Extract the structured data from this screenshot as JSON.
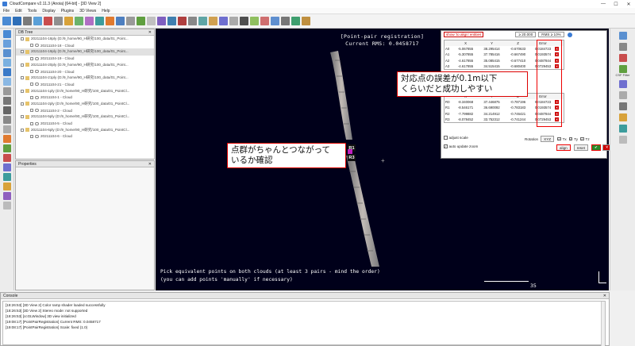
{
  "window": {
    "title": "CloudCompare v2.11.3 (Anoia) [64-bit] - [3D View 2]",
    "controls": [
      "—",
      "☐",
      "✕"
    ]
  },
  "menu": [
    "File",
    "Edit",
    "Tools",
    "Display",
    "Plugins",
    "3D Views",
    "Help"
  ],
  "db_tree": {
    "title": "DB Tree",
    "items": [
      {
        "kind": "parent",
        "label": "20211104-18ply (D:/9_home/90_H研究/100_data/01_Point...",
        "selected": false
      },
      {
        "kind": "child",
        "label": "20211104-18 - Cloud"
      },
      {
        "kind": "parent",
        "label": "20211104-19ply (D:/9_home/90_H研究/100_data/01_Point...",
        "selected": true
      },
      {
        "kind": "child",
        "label": "20211104-19 - Cloud"
      },
      {
        "kind": "parent",
        "label": "20211104-20ply (D:/9_home/90_H研究/100_data/01_Point...",
        "selected": false
      },
      {
        "kind": "child",
        "label": "20211104-20 - Cloud"
      },
      {
        "kind": "parent",
        "label": "20211104-21ply (D:/9_home/90_H研究/100_data/01_Point...",
        "selected": false
      },
      {
        "kind": "child",
        "label": "20211104-21 - Cloud"
      },
      {
        "kind": "parent",
        "label": "20211104-1ply (D:/9_home/90_H研究/100_data/01_PointCl...",
        "selected": false
      },
      {
        "kind": "child",
        "label": "20211104-1 - Cloud"
      },
      {
        "kind": "parent",
        "label": "20211104-2ply (D:/9_home/90_H研究/100_data/01_PointCl...",
        "selected": false
      },
      {
        "kind": "child",
        "label": "20211104-2 - Cloud"
      },
      {
        "kind": "parent",
        "label": "20211104-5ply (D:/9_home/90_H研究/100_data/01_PointCl...",
        "selected": false
      },
      {
        "kind": "child",
        "label": "20211104-5 - Cloud"
      },
      {
        "kind": "parent",
        "label": "20211104-6ply (D:/9_home/90_H研究/100_data/01_PointCl...",
        "selected": false
      },
      {
        "kind": "child",
        "label": "20211104-6 - Cloud"
      }
    ]
  },
  "properties": {
    "title": "Properties"
  },
  "view": {
    "title_line1": "[Point-pair registration]",
    "title_line2": "Current RMS: 0.0458717",
    "hint_line1": "Pick equivalent points on both clouds (at least 3 pairs - mind the order)",
    "hint_line2": "(you can add points 'manually' if necessary)",
    "scale_label": "35",
    "markers": [
      "R1",
      "R2",
      "R3"
    ]
  },
  "registration": {
    "show_button": "show 'to align' entities",
    "rms_field": "≥ 20.000",
    "rms_field2": "RMS ≥ 10%",
    "columns": [
      "",
      "X",
      "Y",
      "Z",
      "Error"
    ],
    "table_a": [
      [
        "A0",
        "-5.067855",
        "38.295414",
        "-0.670633",
        "0.0184723"
      ],
      [
        "A1",
        "-5.307855",
        "37.785416",
        "-0.667490",
        "0.0193574"
      ],
      [
        "A2",
        "-4.617855",
        "35.085415",
        "-0.677410",
        "0.0487844"
      ],
      [
        "A3",
        "-4.617855",
        "34.515415",
        "-0.680400",
        "0.0729453"
      ]
    ],
    "table_r": [
      [
        "R0",
        "-8.340068",
        "37.446875",
        "-0.787196",
        "0.0184723"
      ],
      [
        "R1",
        "-8.546171",
        "36.690092",
        "-0.783183",
        "0.0193574"
      ],
      [
        "R2",
        "-7.799882",
        "34.214912",
        "-0.746421",
        "0.0487844"
      ],
      [
        "R3",
        "-8.078452",
        "33.752312",
        "-0.741244",
        "0.0729453"
      ]
    ],
    "adjust_scale": "adjust scale",
    "auto_update_zoom": "auto update zoom",
    "rotation_label": "Rotation",
    "rotation_value": "XYZ",
    "tx": "Tx",
    "ty": "Ty",
    "tz": "Tz",
    "align_button": "align",
    "reset_button": "reset",
    "ok_icon": "✔",
    "cancel_icon": "✕"
  },
  "annotations": {
    "callout_error_line1": "対応点の誤差が0.1m以下",
    "callout_error_line2": "くらいだと成功しやすい",
    "callout_connect_line1": "点群がちゃんとつながって",
    "callout_connect_line2": "いるか確認"
  },
  "right_strip": {
    "csf_label": "CSF Filter"
  },
  "console": {
    "title": "Console",
    "lines": [
      "[18:26:53] [3D View 2] Color ramp shader loaded successfully",
      "[18:26:53] [3D View 2] Stereo mode: not supported",
      "[18:26:53] [ccGLWindow] 3D view initialized",
      "[19:08:17] [PointPairRegistration] Current RMS: 0.0458717",
      "[19:08:17] [PointPairRegistration] Scale: fixed (1.0)"
    ]
  },
  "colors": {
    "view_bg": "#00001a",
    "accent_red": "#dd0000",
    "tree_folder": "#e6c36a"
  }
}
